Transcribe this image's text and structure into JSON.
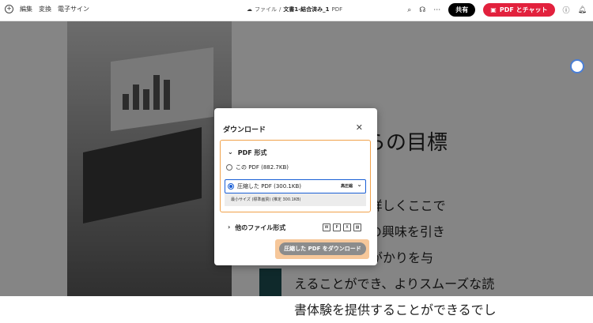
{
  "toolbar": {
    "menu": [
      "編集",
      "変換",
      "電子サイン"
    ],
    "breadcrumb_root": "ファイル",
    "doc_name": "文書1-結合済み_1",
    "doc_type": "PDF",
    "share_label": "共有",
    "chat_label": "PDF とチャット"
  },
  "document": {
    "heading": "らの目標",
    "body_lines": [
      "の内容をより詳しくここで",
      "ことで、読者の興味を引き",
      "また読解の手がかりを与",
      "えることができ、よりスムーズな読",
      "書体験を提供することができるでし"
    ]
  },
  "dialog": {
    "title": "ダウンロード",
    "pdf_section_title": "PDF 形式",
    "option_this_pdf": "この PDF (882.7KB)",
    "option_compressed": "圧縮した PDF (300.1KB)",
    "quality_label": "高圧縮",
    "dropdown_option": "最小サイズ (標準画質) (推定 300.1KB)",
    "other_formats": "他のファイル形式",
    "download_button": "圧縮した PDF をダウンロード"
  },
  "colors": {
    "accent": "#1a5fd6",
    "highlight_border": "#f0a14a",
    "chat_button": "#e2213d",
    "teal_bar": "#1e4f53"
  }
}
